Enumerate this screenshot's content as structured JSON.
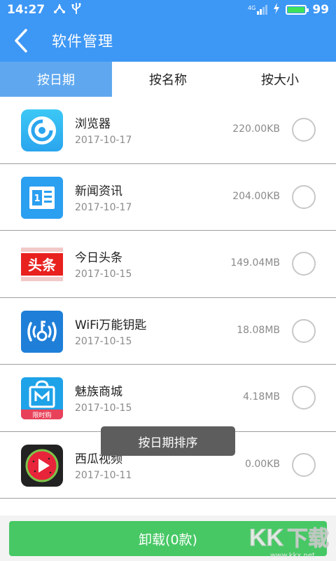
{
  "status_bar": {
    "time": "14:27",
    "icons": [
      "usb-share-icon",
      "usb-icon"
    ],
    "network_label": "4G",
    "battery_level_pct": 99,
    "battery": "99"
  },
  "header": {
    "title": "软件管理",
    "back_icon": "chevron-left-icon"
  },
  "tabs": [
    {
      "label": "按日期",
      "active": true
    },
    {
      "label": "按名称",
      "active": false
    },
    {
      "label": "按大小",
      "active": false
    }
  ],
  "apps": [
    {
      "name": "浏览器",
      "date": "2017-10-17",
      "size": "220.00KB",
      "icon": "browser-icon"
    },
    {
      "name": "新闻资讯",
      "date": "2017-10-17",
      "size": "204.00KB",
      "icon": "news-icon"
    },
    {
      "name": "今日头条",
      "date": "2017-10-15",
      "size": "149.04MB",
      "icon": "toutiao-icon",
      "icon_text": "头条"
    },
    {
      "name": "WiFi万能钥匙",
      "date": "2017-10-15",
      "size": "18.08MB",
      "icon": "wifi-key-icon"
    },
    {
      "name": "魅族商城",
      "date": "2017-10-15",
      "size": "4.18MB",
      "icon": "meizu-mall-icon",
      "icon_text": "限时购"
    },
    {
      "name": "西瓜视频",
      "date": "2017-10-11",
      "size": "0.00KB",
      "icon": "xigua-video-icon"
    }
  ],
  "toast": {
    "text": "按日期排序"
  },
  "bottom": {
    "uninstall_label": "卸载(0款)"
  },
  "watermark": {
    "text": "KK下载",
    "url": "www.kkx.net"
  },
  "colors": {
    "primary": "#3d97f5",
    "tab_active": "#5fa8ef",
    "button": "#47c865"
  }
}
